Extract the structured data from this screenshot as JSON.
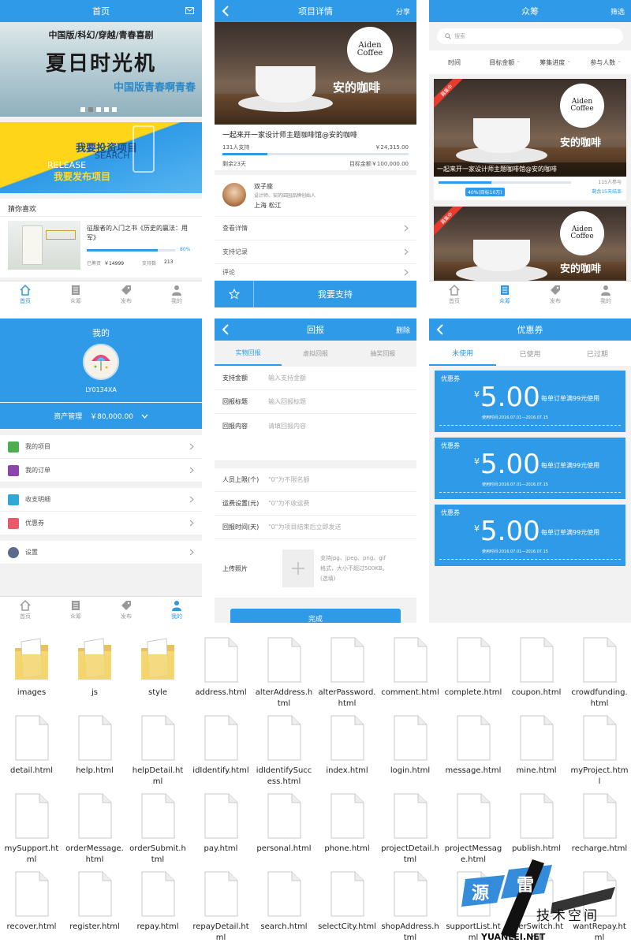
{
  "colors": {
    "accent": "#2f9ae8",
    "bg": "#f2f2f2"
  },
  "tabs": {
    "home": "首页",
    "crowd": "众筹",
    "publish": "发布",
    "mine": "我的"
  },
  "home": {
    "title": "首页",
    "banner_top": "中国版/科幻/穿越/青春喜剧",
    "banner_main": "夏日时光机",
    "banner_sub": "中国版青春啊青春",
    "promo_main": "我要投资项目",
    "promo_search": "SEARCH",
    "promo_release": "RELEASE",
    "promo_publish": "我要发布项目",
    "guess_title": "猜你喜欢",
    "item_title": "征服者的入门之书《历史的赢法：用军》",
    "item_progress_pct": "80%",
    "item_progress": 0.8,
    "item_raised_label": "已筹资",
    "item_raised": "￥14999",
    "item_support_label": "支持数",
    "item_support": "213"
  },
  "detail": {
    "title": "项目详情",
    "share": "分享",
    "project_title": "一起来开一家设计师主题咖啡馆@安的咖啡",
    "supporters": "131人支持",
    "raised": "￥24,315.00",
    "progress": 0.24,
    "remaining": "剩余23天",
    "target": "目标金额￥100,000.00",
    "user_name": "双子座",
    "user_desc": "设计师、安的田园品牌创始人",
    "user_location": "上海 松江",
    "menu": [
      "查看详情",
      "支持记录",
      "评论"
    ],
    "support_button": "我要支持",
    "cafe_logo_1": "Aiden",
    "cafe_logo_2": "Coffee",
    "cafe_name": "安的咖啡"
  },
  "crowd": {
    "title": "众筹",
    "filter": "筛选",
    "search_placeholder": "搜索",
    "sorts": [
      "时间",
      "目标金额",
      "筹集进度",
      "参与人数"
    ],
    "badge": "募集中",
    "card_title": "一起来开一家设计师主题咖啡馆@安的咖啡",
    "participants": "115人参与",
    "progress_label": "40%(目标10万)",
    "progress": 0.4,
    "remaining": "剩余15天结束"
  },
  "mine": {
    "title": "我的",
    "user_id": "LY0134XA",
    "asset_label": "资产管理",
    "asset_value": "￥80,000.00",
    "menu1": [
      "我的项目",
      "我的订单"
    ],
    "menu2": [
      "收支明细",
      "优惠券"
    ],
    "menu3": [
      "设置"
    ]
  },
  "reward": {
    "title": "回报",
    "delete": "删除",
    "tabs": [
      "实物回报",
      "虚拟回报",
      "抽奖回报"
    ],
    "fields1": [
      {
        "label": "支持金额",
        "placeholder": "输入支持金额"
      },
      {
        "label": "回报标题",
        "placeholder": "输入回报标题"
      },
      {
        "label": "回报内容",
        "placeholder": "请填回报内容"
      }
    ],
    "fields2": [
      {
        "label": "人员上限(个)",
        "placeholder": "\"0\"为不限名额"
      },
      {
        "label": "运费设置(元)",
        "placeholder": "\"0\"为不收运费"
      },
      {
        "label": "回报时间(天)",
        "placeholder": "\"0\"为项目结束后立即发送"
      }
    ],
    "upload_label": "上传照片",
    "upload_hint": "支持jpg、jpeg、png、gif格式，大小不超过500KB。(选填)",
    "done": "完成"
  },
  "coupon": {
    "title": "优惠券",
    "tabs": [
      "未使用",
      "已使用",
      "已过期"
    ],
    "items": [
      {
        "tag": "优惠券",
        "amount": "5.00",
        "rule": "每单订单满99元使用",
        "date": "使用时间:2016.07.01—2016.07.15"
      },
      {
        "tag": "优惠券",
        "amount": "5.00",
        "rule": "每单订单满99元使用",
        "date": "使用时间:2016.07.01—2016.07.15"
      },
      {
        "tag": "优惠券",
        "amount": "5.00",
        "rule": "每单订单满99元使用",
        "date": "使用时间:2016.07.01—2016.07.15"
      }
    ]
  },
  "files": [
    {
      "name": "images",
      "type": "folder"
    },
    {
      "name": "js",
      "type": "folder"
    },
    {
      "name": "style",
      "type": "folder"
    },
    {
      "name": "address.html",
      "type": "file"
    },
    {
      "name": "alterAddress.html",
      "type": "file"
    },
    {
      "name": "alterPassword.html",
      "type": "file"
    },
    {
      "name": "comment.html",
      "type": "file"
    },
    {
      "name": "complete.html",
      "type": "file"
    },
    {
      "name": "coupon.html",
      "type": "file"
    },
    {
      "name": "crowdfunding.html",
      "type": "file"
    },
    {
      "name": "detail.html",
      "type": "file"
    },
    {
      "name": "help.html",
      "type": "file"
    },
    {
      "name": "helpDetail.html",
      "type": "file"
    },
    {
      "name": "idIdentify.html",
      "type": "file"
    },
    {
      "name": "idIdentifySuccess.html",
      "type": "file"
    },
    {
      "name": "index.html",
      "type": "file"
    },
    {
      "name": "login.html",
      "type": "file"
    },
    {
      "name": "message.html",
      "type": "file"
    },
    {
      "name": "mine.html",
      "type": "file"
    },
    {
      "name": "myProject.html",
      "type": "file"
    },
    {
      "name": "mySupport.html",
      "type": "file"
    },
    {
      "name": "orderMessage.html",
      "type": "file"
    },
    {
      "name": "orderSubmit.html",
      "type": "file"
    },
    {
      "name": "pay.html",
      "type": "file"
    },
    {
      "name": "personal.html",
      "type": "file"
    },
    {
      "name": "phone.html",
      "type": "file"
    },
    {
      "name": "projectDetail.html",
      "type": "file"
    },
    {
      "name": "projectMessage.html",
      "type": "file"
    },
    {
      "name": "publish.html",
      "type": "file"
    },
    {
      "name": "recharge.html",
      "type": "file"
    },
    {
      "name": "recover.html",
      "type": "file"
    },
    {
      "name": "register.html",
      "type": "file"
    },
    {
      "name": "repay.html",
      "type": "file"
    },
    {
      "name": "repayDetail.html",
      "type": "file"
    },
    {
      "name": "search.html",
      "type": "file"
    },
    {
      "name": "selectCity.html",
      "type": "file"
    },
    {
      "name": "shopAddress.html",
      "type": "file"
    },
    {
      "name": "supportList.html",
      "type": "file"
    },
    {
      "name": "userSwitch.html",
      "type": "file"
    },
    {
      "name": "wantRepay.html",
      "type": "file"
    }
  ],
  "watermark": {
    "c1": "源",
    "c2": "雷",
    "line1": "技术空间",
    "url": "YUANLEI.NET"
  }
}
